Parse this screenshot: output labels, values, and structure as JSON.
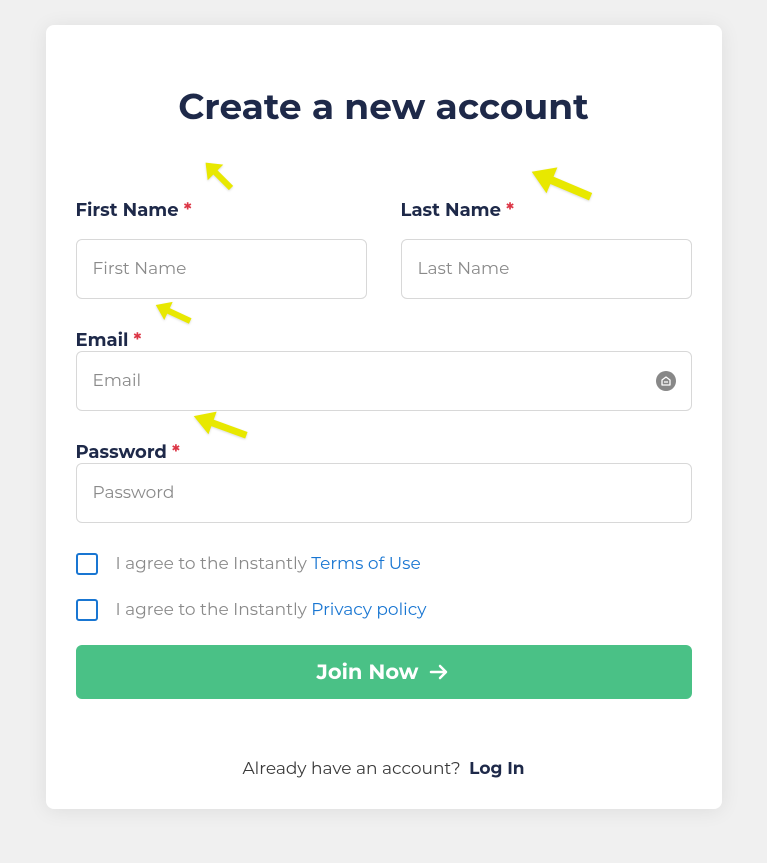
{
  "title": "Create a new account",
  "fields": {
    "firstName": {
      "label": "First Name",
      "placeholder": "First Name",
      "required": "*"
    },
    "lastName": {
      "label": "Last Name",
      "placeholder": "Last Name",
      "required": "*"
    },
    "email": {
      "label": "Email",
      "placeholder": "Email",
      "required": "*"
    },
    "password": {
      "label": "Password",
      "placeholder": "Password",
      "required": "*"
    }
  },
  "checkboxes": {
    "terms": {
      "prefix": "I agree to the Instantly ",
      "linkText": "Terms of Use"
    },
    "privacy": {
      "prefix": "I agree to the Instantly ",
      "linkText": "Privacy policy"
    }
  },
  "submit": "Join Now",
  "footer": {
    "question": "Already have an account?",
    "loginText": "Log In"
  },
  "colors": {
    "primary": "#1e2949",
    "accent": "#4ac186",
    "link": "#1976d2",
    "required": "#dc3545",
    "annotation": "#e8e800"
  }
}
